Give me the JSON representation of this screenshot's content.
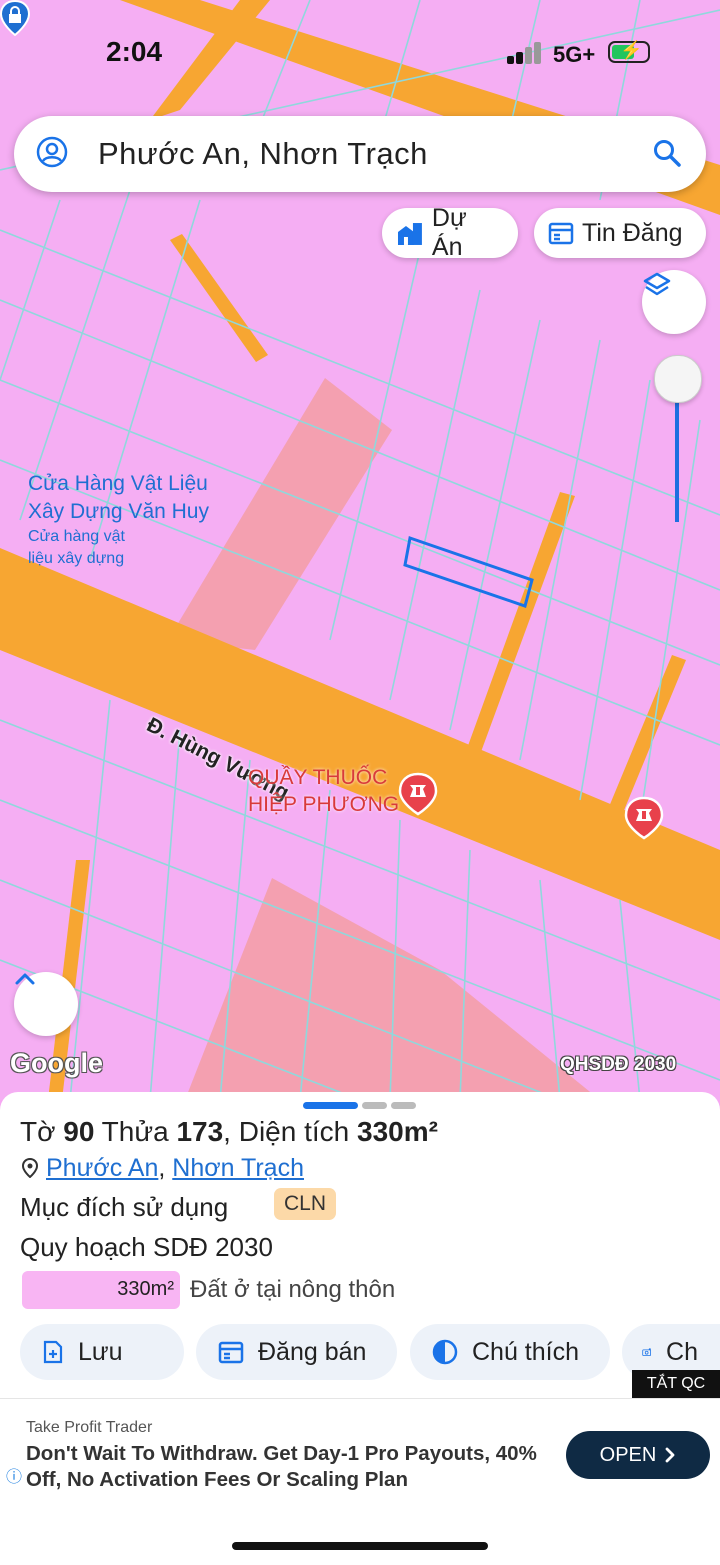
{
  "status": {
    "time": "2:04",
    "network": "5G+"
  },
  "search": {
    "query": "Phước An, Nhơn Trạch"
  },
  "chips": {
    "du_an": "Dự Án",
    "tin_dang": "Tin Đăng"
  },
  "map": {
    "store_label": {
      "title_1": "Cửa Hàng Vật Liệu",
      "title_2": "Xây Dựng Văn Huy",
      "sub_1": "Cửa hàng vật",
      "sub_2": "liệu xây dựng"
    },
    "road_name": "Đ. Hùng Vương",
    "pharmacy": {
      "line1": "QUẦY THUỐC",
      "line2": "HIỆP PHƯƠNG"
    },
    "google": "Google",
    "overlay": "QHSDĐ 2030"
  },
  "sheet": {
    "title_pre": "Tờ ",
    "to": "90",
    "title_mid": " Thửa ",
    "thua": "173",
    "title_suffix": ", Diện tích ",
    "area": "330m²",
    "ward": "Phước An",
    "district": "Nhơn Trạch",
    "muc_dich_label": "Mục đích sử dụng",
    "muc_dich_code": "CLN",
    "quy_hoach_label": "Quy hoạch SDĐ 2030",
    "legend_area": "330m²",
    "legend_desc": "Đất ở tại nông thôn",
    "actions": {
      "luu": "Lưu",
      "dang_ban": "Đăng bán",
      "chu_thich": "Chú thích",
      "chia_se": "Ch"
    },
    "colors": {
      "land_residential": "#f8b5f3",
      "cln_badge": "#fcd9a8",
      "accent": "#1f6fd1"
    }
  },
  "ad": {
    "tat_qc": "TẮT QC",
    "advertiser": "Take Profit Trader",
    "headline": "Don't Wait To Withdraw. Get Day-1 Pro Payouts, 40% Off, No Activation Fees Or Scaling Plan",
    "cta": "OPEN"
  }
}
